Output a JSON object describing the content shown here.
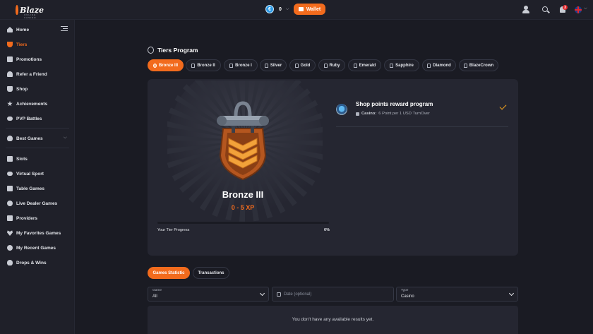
{
  "brand": {
    "name": "Blaze",
    "tagline": "ONLINE CASINO"
  },
  "header": {
    "balance": "0",
    "wallet_label": "Wallet",
    "notifications_count": "3"
  },
  "sidebar": {
    "items": [
      {
        "label": "Home",
        "icon": "home-icon"
      },
      {
        "label": "Tiers",
        "icon": "trophy-icon",
        "active": true
      },
      {
        "label": "Promotions",
        "icon": "gift-icon"
      },
      {
        "label": "Refer a Friend",
        "icon": "people-icon"
      },
      {
        "label": "Shop",
        "icon": "cart-icon"
      },
      {
        "label": "Achievements",
        "icon": "star-icon"
      },
      {
        "label": "PVP Battles",
        "icon": "gamepad-icon"
      },
      {
        "label": "Best Games",
        "icon": "flame-icon"
      },
      {
        "label": "Slots",
        "icon": "slot-icon"
      },
      {
        "label": "Virtual Sport",
        "icon": "gamepad-icon"
      },
      {
        "label": "Table Games",
        "icon": "cards-icon"
      },
      {
        "label": "Live Dealer Games",
        "icon": "dealer-icon"
      },
      {
        "label": "Providers",
        "icon": "provider-icon"
      },
      {
        "label": "My Favorites Games",
        "icon": "heart-icon"
      },
      {
        "label": "My Recent Games",
        "icon": "clock-icon"
      },
      {
        "label": "Drops & Wins",
        "icon": "drop-icon"
      }
    ]
  },
  "page": {
    "title": "Tiers Program"
  },
  "tiers": [
    {
      "label": "Bronze III",
      "active": true
    },
    {
      "label": "Bronze II"
    },
    {
      "label": "Bronze I"
    },
    {
      "label": "Silver"
    },
    {
      "label": "Gold"
    },
    {
      "label": "Ruby"
    },
    {
      "label": "Emerald"
    },
    {
      "label": "Sapphire"
    },
    {
      "label": "Diamond"
    },
    {
      "label": "BlazeCrown"
    }
  ],
  "current_tier": {
    "name": "Bronze III",
    "xp_range": "0 - 5 XP",
    "progress_label": "Your Tier Progress",
    "progress_pct": "0%",
    "progress_value": 0,
    "colors": {
      "shield": "#b4561f",
      "chevron": "#f2a23a",
      "accent": "#f26b1d"
    }
  },
  "reward": {
    "title": "Shop points reward program",
    "category": "Casino:",
    "detail": "6 Point per 1 USD TurnOver"
  },
  "section_tabs": [
    {
      "label": "Games Statistic",
      "active": true
    },
    {
      "label": "Transactions"
    }
  ],
  "filters": {
    "game": {
      "label": "Game",
      "value": "All"
    },
    "date": {
      "placeholder": "Date (optional)"
    },
    "type": {
      "label": "Type",
      "value": "Casino"
    }
  },
  "results": {
    "empty_text": "You don't have any available results yet."
  }
}
